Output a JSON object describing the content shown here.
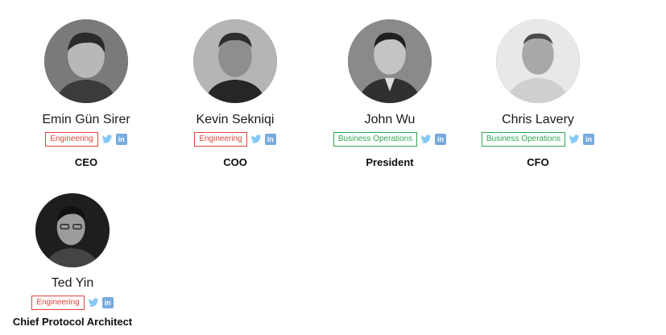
{
  "team": [
    {
      "name": "Emin Gün Sirer",
      "department": "Engineering",
      "department_kind": "engineering",
      "role": "CEO",
      "social": {
        "twitter_icon": "twitter-icon",
        "linkedin_label": "in"
      }
    },
    {
      "name": "Kevin Sekniqi",
      "department": "Engineering",
      "department_kind": "engineering",
      "role": "COO",
      "social": {
        "twitter_icon": "twitter-icon",
        "linkedin_label": "in"
      }
    },
    {
      "name": "John Wu",
      "department": "Business Operations",
      "department_kind": "business",
      "role": "President",
      "social": {
        "twitter_icon": "twitter-icon",
        "linkedin_label": "in"
      }
    },
    {
      "name": "Chris Lavery",
      "department": "Business Operations",
      "department_kind": "business",
      "role": "CFO",
      "social": {
        "twitter_icon": "twitter-icon",
        "linkedin_label": "in"
      }
    },
    {
      "name": "Ted Yin",
      "department": "Engineering",
      "department_kind": "engineering",
      "role": "Chief Protocol Architect",
      "social": {
        "twitter_icon": "twitter-icon",
        "linkedin_label": "in"
      }
    }
  ],
  "colors": {
    "engineering": "#e0463c",
    "business": "#2fa84f",
    "twitter": "#1d9bf0",
    "linkedin": "#0a66c2"
  }
}
